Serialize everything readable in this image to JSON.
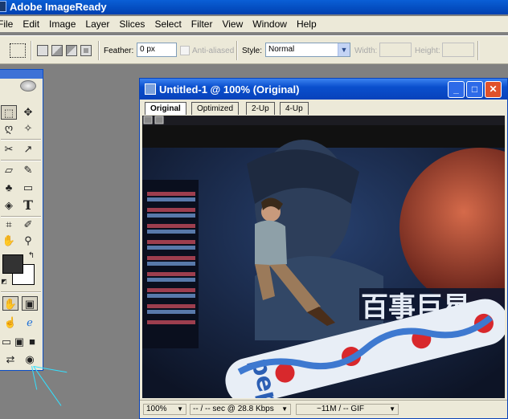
{
  "app": {
    "title": "Adobe ImageReady"
  },
  "menu": [
    "File",
    "Edit",
    "Image",
    "Layer",
    "Slices",
    "Select",
    "Filter",
    "View",
    "Window",
    "Help"
  ],
  "options": {
    "feather_label": "Feather:",
    "feather_value": "0 px",
    "anti_aliased_label": "Anti-aliased",
    "style_label": "Style:",
    "style_value": "Normal",
    "width_label": "Width:",
    "height_label": "Height:"
  },
  "document": {
    "title": "Untitled-1 @ 100% (Original)",
    "tabs": [
      "Original",
      "Optimized",
      "2-Up",
      "4-Up"
    ],
    "active_tab": "Original",
    "status": {
      "zoom": "100%",
      "speed": "-- / -- sec @ 28.8 Kbps",
      "size": "~11M / -- GIF"
    },
    "image": {
      "signage_text": "百事巨星",
      "can_text": "pepsi"
    }
  },
  "colors": {
    "titlebar": "#0a5fd6",
    "chrome": "#ece9d8",
    "foreground_color": "#333333",
    "background_color": "#ffffff"
  },
  "icons": {
    "toolbox": [
      "marquee-icon",
      "move-icon",
      "lasso-icon",
      "magic-wand-icon",
      "slice-icon",
      "eyedropper-icon",
      "eraser-icon",
      "brush-icon",
      "clone-stamp-icon",
      "rectangle-icon",
      "paint-bucket-icon",
      "type-icon",
      "crop-icon",
      "color-sampler-icon",
      "hand-icon",
      "zoom-icon"
    ]
  }
}
